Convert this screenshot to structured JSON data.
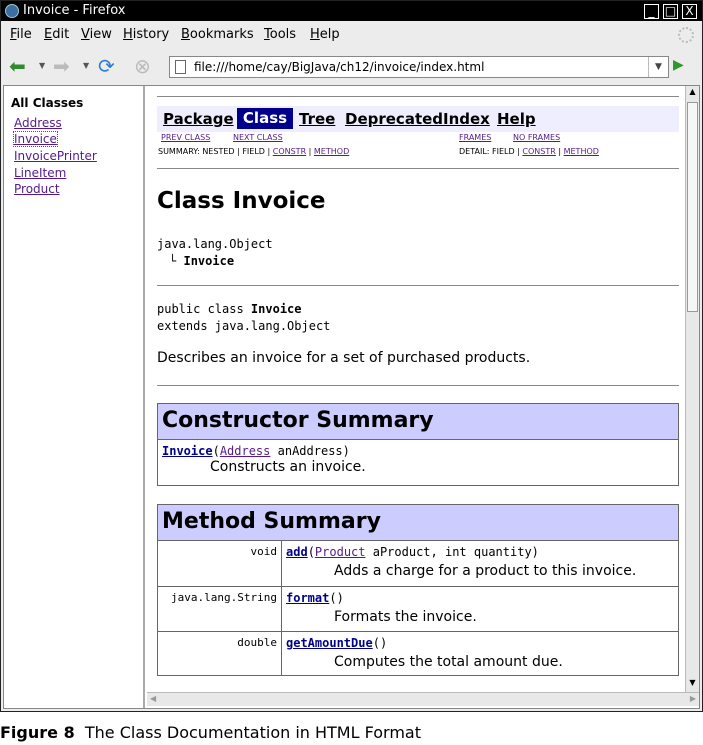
{
  "window": {
    "title": "Invoice - Firefox",
    "min_symbol": "_",
    "max_symbol": "□",
    "close_symbol": "X"
  },
  "menubar": {
    "items": [
      "File",
      "Edit",
      "View",
      "History",
      "Bookmarks",
      "Tools",
      "Help"
    ]
  },
  "navbar": {
    "url": "file:///home/cay/BigJava/ch12/invoice/index.html"
  },
  "left_frame": {
    "heading": "All Classes",
    "classes": [
      "Address",
      "Invoice",
      "InvoicePrinter",
      "LineItem",
      "Product"
    ]
  },
  "doc": {
    "nav": [
      "Package",
      "Class",
      "Tree",
      "Deprecated",
      "Index",
      "Help"
    ],
    "prev_class": "PREV CLASS",
    "next_class": "NEXT CLASS",
    "frames": "FRAMES",
    "no_frames": "NO FRAMES",
    "summary_prefix": "SUMMARY: NESTED | FIELD | ",
    "constr": "CONSTR",
    "sep": " | ",
    "method": "METHOD",
    "detail_prefix": "DETAIL: FIELD | ",
    "class_title": "Class Invoice",
    "hierarchy_root": "java.lang.Object",
    "hierarchy_child": "Invoice",
    "decl_line1_prefix": "public class ",
    "decl_line1_name": "Invoice",
    "decl_line2": "extends java.lang.Object",
    "description": "Describes an invoice for a set of purchased products.",
    "constructor_summary": {
      "title": "Constructor Summary",
      "name": "Invoice",
      "param_type": "Address",
      "param_rest": " anAddress)",
      "desc": "Constructs an invoice."
    },
    "method_summary": {
      "title": "Method Summary",
      "methods": [
        {
          "ret": "void",
          "name": "add",
          "type_link": "Product",
          "sig_rest": " aProduct, int quantity)",
          "desc": "Adds a charge for a product to this invoice."
        },
        {
          "ret": "java.lang.String",
          "name": "format",
          "type_link": "",
          "sig_rest": ")",
          "desc": "Formats the invoice."
        },
        {
          "ret": "double",
          "name": "getAmountDue",
          "type_link": "",
          "sig_rest": ")",
          "desc": "Computes the total amount due."
        }
      ]
    }
  },
  "caption": {
    "label": "Figure 8",
    "text": "The Class Documentation in HTML Format"
  }
}
